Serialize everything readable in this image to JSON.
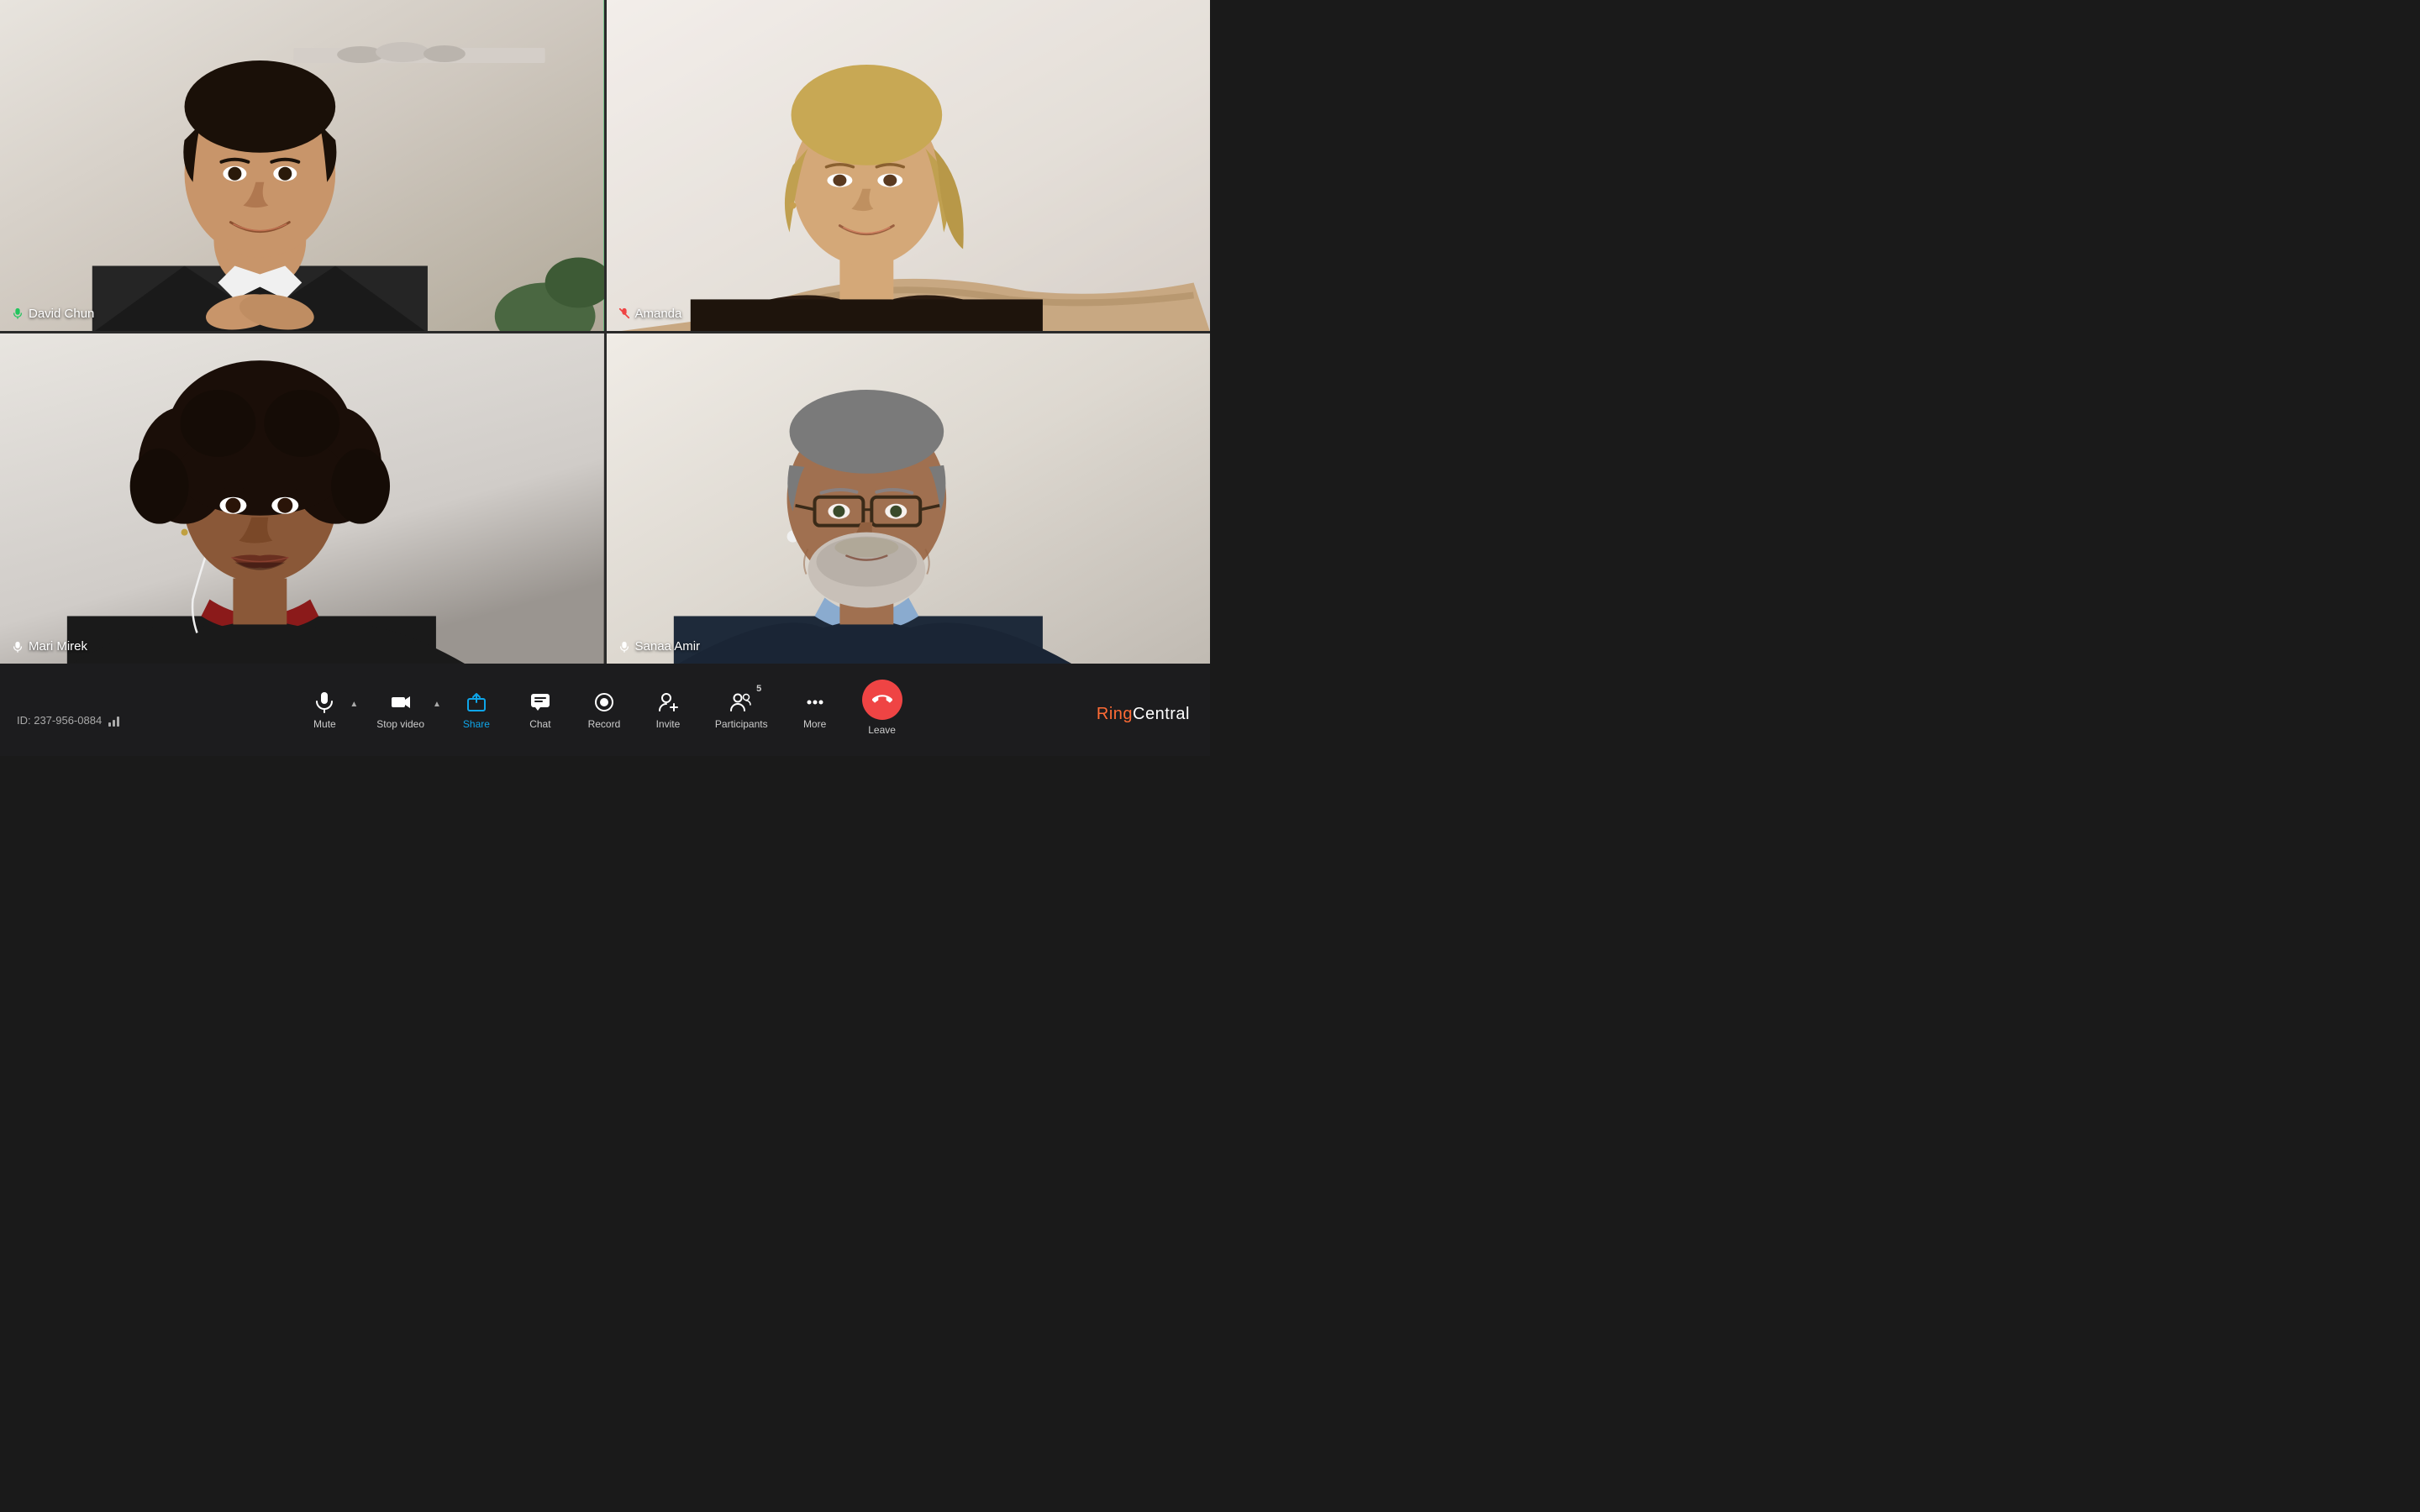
{
  "meeting": {
    "id": "ID: 237-956-0884",
    "signal_bars": 3
  },
  "participants": [
    {
      "id": "david-chun",
      "name": "David Chun",
      "muted": false,
      "active_speaker": true,
      "tile_class": "tile-david"
    },
    {
      "id": "amanda",
      "name": "Amanda",
      "muted": true,
      "active_speaker": false,
      "tile_class": "tile-amanda"
    },
    {
      "id": "mari-mirek",
      "name": "Mari Mirek",
      "muted": false,
      "active_speaker": false,
      "tile_class": "tile-mari"
    },
    {
      "id": "sanaa-amir",
      "name": "Sanaa Amir",
      "muted": false,
      "active_speaker": false,
      "tile_class": "tile-sanaa"
    }
  ],
  "toolbar": {
    "mute_label": "Mute",
    "stop_video_label": "Stop video",
    "share_label": "Share",
    "chat_label": "Chat",
    "record_label": "Record",
    "invite_label": "Invite",
    "participants_label": "Participants",
    "participants_count": "5",
    "more_label": "More",
    "leave_label": "Leave"
  },
  "brand": {
    "ring": "Ring",
    "central": "Central"
  },
  "colors": {
    "active_speaker_border": "#22c55e",
    "toolbar_bg": "#1c1c1e",
    "leave_bg": "#ef4444",
    "share_icon": "#0ea5e9",
    "muted_mic": "#ef4444"
  }
}
